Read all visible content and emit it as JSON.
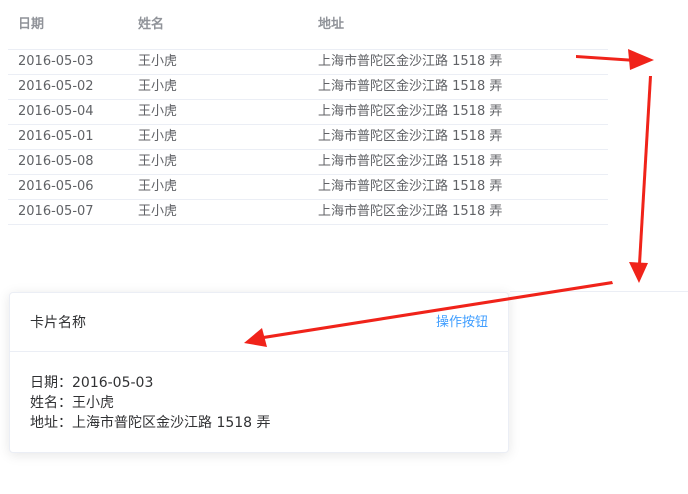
{
  "table": {
    "columns": [
      "日期",
      "姓名",
      "地址"
    ],
    "rows": [
      {
        "date": "2016-05-03",
        "name": "王小虎",
        "address": "上海市普陀区金沙江路 1518 弄"
      },
      {
        "date": "2016-05-02",
        "name": "王小虎",
        "address": "上海市普陀区金沙江路 1518 弄"
      },
      {
        "date": "2016-05-04",
        "name": "王小虎",
        "address": "上海市普陀区金沙江路 1518 弄"
      },
      {
        "date": "2016-05-01",
        "name": "王小虎",
        "address": "上海市普陀区金沙江路 1518 弄"
      },
      {
        "date": "2016-05-08",
        "name": "王小虎",
        "address": "上海市普陀区金沙江路 1518 弄"
      },
      {
        "date": "2016-05-06",
        "name": "王小虎",
        "address": "上海市普陀区金沙江路 1518 弄"
      },
      {
        "date": "2016-05-07",
        "name": "王小虎",
        "address": "上海市普陀区金沙江路 1518 弄"
      }
    ]
  },
  "card": {
    "title": "卡片名称",
    "action_label": "操作按钮",
    "fields": {
      "date": "日期：2016-05-03",
      "name": "姓名：王小虎",
      "address": "地址：上海市普陀区金沙江路 1518 弄"
    }
  },
  "colors": {
    "arrow": "#f0231a",
    "link": "#409eff",
    "border": "#ebeef5"
  }
}
